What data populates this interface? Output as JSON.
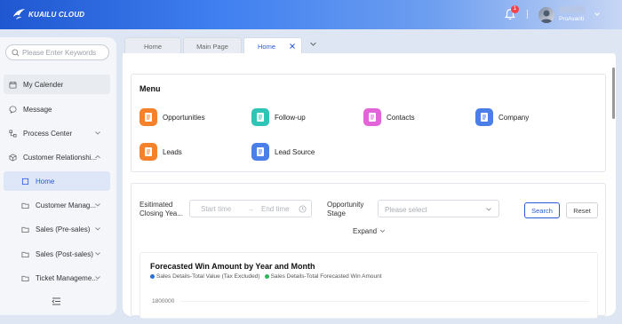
{
  "header": {
    "brand": "KUAILU CLOUD",
    "notification_count": "1",
    "username": "ProAvanti",
    "gradient_start": "#1f57d0",
    "gradient_end": "#c7d6f4"
  },
  "sidebar": {
    "search_placeholder": "Please Enter Keywords",
    "items": [
      {
        "label": "My Calender",
        "icon": "calendar-icon"
      },
      {
        "label": "Message",
        "icon": "message-icon"
      },
      {
        "label": "Process Center",
        "icon": "process-icon"
      },
      {
        "label": "Customer Relationshi...",
        "icon": "cube-icon"
      },
      {
        "label": "Home",
        "icon": "home-icon"
      },
      {
        "label": "Customer Manag...",
        "icon": "folder-icon"
      },
      {
        "label": "Sales (Pre-sales)",
        "icon": "folder-icon"
      },
      {
        "label": "Sales (Post-sales)",
        "icon": "folder-icon"
      },
      {
        "label": "Ticket Manageme...",
        "icon": "folder-icon"
      }
    ]
  },
  "tabs": [
    {
      "label": "Home"
    },
    {
      "label": "Main Page"
    },
    {
      "label": "Home"
    }
  ],
  "menu": {
    "title": "Menu",
    "items": [
      {
        "label": "Opportunities",
        "color": "#f5822a"
      },
      {
        "label": "Follow-up",
        "color": "#2ec4b6"
      },
      {
        "label": "Contacts",
        "color": "#e264d8"
      },
      {
        "label": "Company",
        "color": "#4a7ee8"
      },
      {
        "label": "Leads",
        "color": "#f5822a"
      },
      {
        "label": "Lead Source",
        "color": "#4a7ee8"
      }
    ]
  },
  "filters": {
    "closing_label_1": "Esitimated",
    "closing_label_2": "Closing Yea...",
    "start_placeholder": "Start time",
    "arrow": "→",
    "end_placeholder": "End time",
    "stage_label_1": "Opportunity",
    "stage_label_2": "Stage",
    "stage_placeholder": "Please select",
    "search_button": "Search",
    "reset_button": "Reset",
    "expand": "Expand"
  },
  "chart": {
    "title": "Forecasted Win Amount by Year and Month",
    "legend": [
      {
        "name": "Sales Details-Total Value (Tax Excluded)",
        "color": "#2a6fd6"
      },
      {
        "name": "Sales Details-Total Forecasted Win Amount",
        "color": "#2fb55a"
      }
    ],
    "y_tick_top": "1800000"
  },
  "accent_color": "#2a5bd7"
}
